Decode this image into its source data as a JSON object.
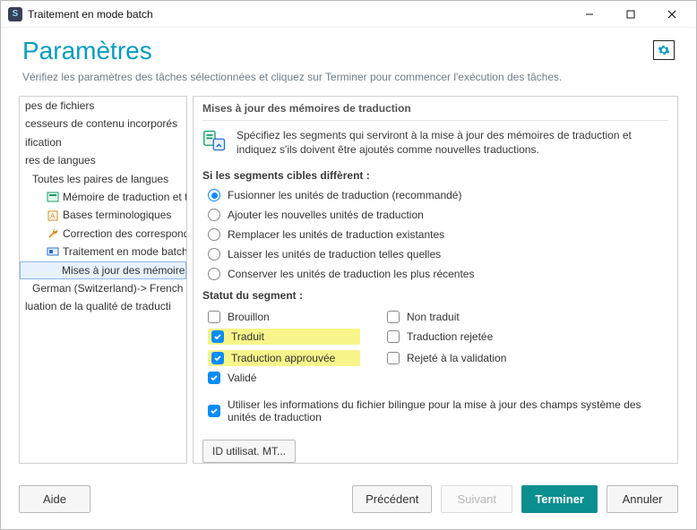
{
  "window": {
    "title": "Traitement en mode batch"
  },
  "header": {
    "title": "Paramètres",
    "subtitle": "Vérifiez les paramètres des tâches sélectionnées et cliquez sur Terminer pour commencer l'exécution des tâches."
  },
  "sidebar": {
    "items": [
      {
        "label": "pes de fichiers",
        "indent": 0
      },
      {
        "label": "cesseurs de contenu incorporés",
        "indent": 0
      },
      {
        "label": "ification",
        "indent": 0
      },
      {
        "label": "res de langues",
        "indent": 0
      },
      {
        "label": "Toutes les paires de langues",
        "indent": 1
      },
      {
        "label": "Mémoire de traduction et t",
        "indent": 2,
        "icon": "tm"
      },
      {
        "label": "Bases terminologiques",
        "indent": 2,
        "icon": "tb"
      },
      {
        "label": "Correction des correspond",
        "indent": 2,
        "icon": "wrench"
      },
      {
        "label": "Traitement en mode batch",
        "indent": 2,
        "icon": "batch"
      },
      {
        "label": "Mises à jour des mémoires",
        "indent": 3,
        "selected": true
      },
      {
        "label": "German (Switzerland)-> French",
        "indent": 1
      },
      {
        "label": "luation de la qualité de traducti",
        "indent": 0
      }
    ]
  },
  "content": {
    "section_title": "Mises à jour des mémoires de traduction",
    "intro": "Spécifiez les segments qui serviront à la mise à jour des mémoires de traduction et indiquez s'ils doivent être ajoutés comme nouvelles traductions.",
    "radio_group_label": "Si les segments cibles diffèrent :",
    "radios": [
      {
        "label": "Fusionner les unités de traduction (recommandé)",
        "checked": true
      },
      {
        "label": "Ajouter les nouvelles unités de traduction",
        "checked": false
      },
      {
        "label": "Remplacer les unités de traduction existantes",
        "checked": false
      },
      {
        "label": "Laisser les unités de traduction telles quelles",
        "checked": false
      },
      {
        "label": "Conserver les unités de traduction les plus récentes",
        "checked": false
      }
    ],
    "status_label": "Statut du segment :",
    "status_checks_left": [
      {
        "label": "Brouillon",
        "checked": false,
        "hl": false
      },
      {
        "label": "Traduit",
        "checked": true,
        "hl": true
      },
      {
        "label": "Traduction approuvée",
        "checked": true,
        "hl": true
      },
      {
        "label": "Validé",
        "checked": true,
        "hl": false
      }
    ],
    "status_checks_right": [
      {
        "label": "Non traduit",
        "checked": false
      },
      {
        "label": "Traduction rejetée",
        "checked": false
      },
      {
        "label": "Rejeté à la validation",
        "checked": false
      }
    ],
    "bilingual_check": {
      "label": "Utiliser les informations du fichier bilingue pour la mise à jour des champs système des unités de traduction",
      "checked": true
    },
    "id_button": "ID utilisat. MT..."
  },
  "footer": {
    "help": "Aide",
    "prev": "Précédent",
    "next": "Suivant",
    "finish": "Terminer",
    "cancel": "Annuler"
  }
}
